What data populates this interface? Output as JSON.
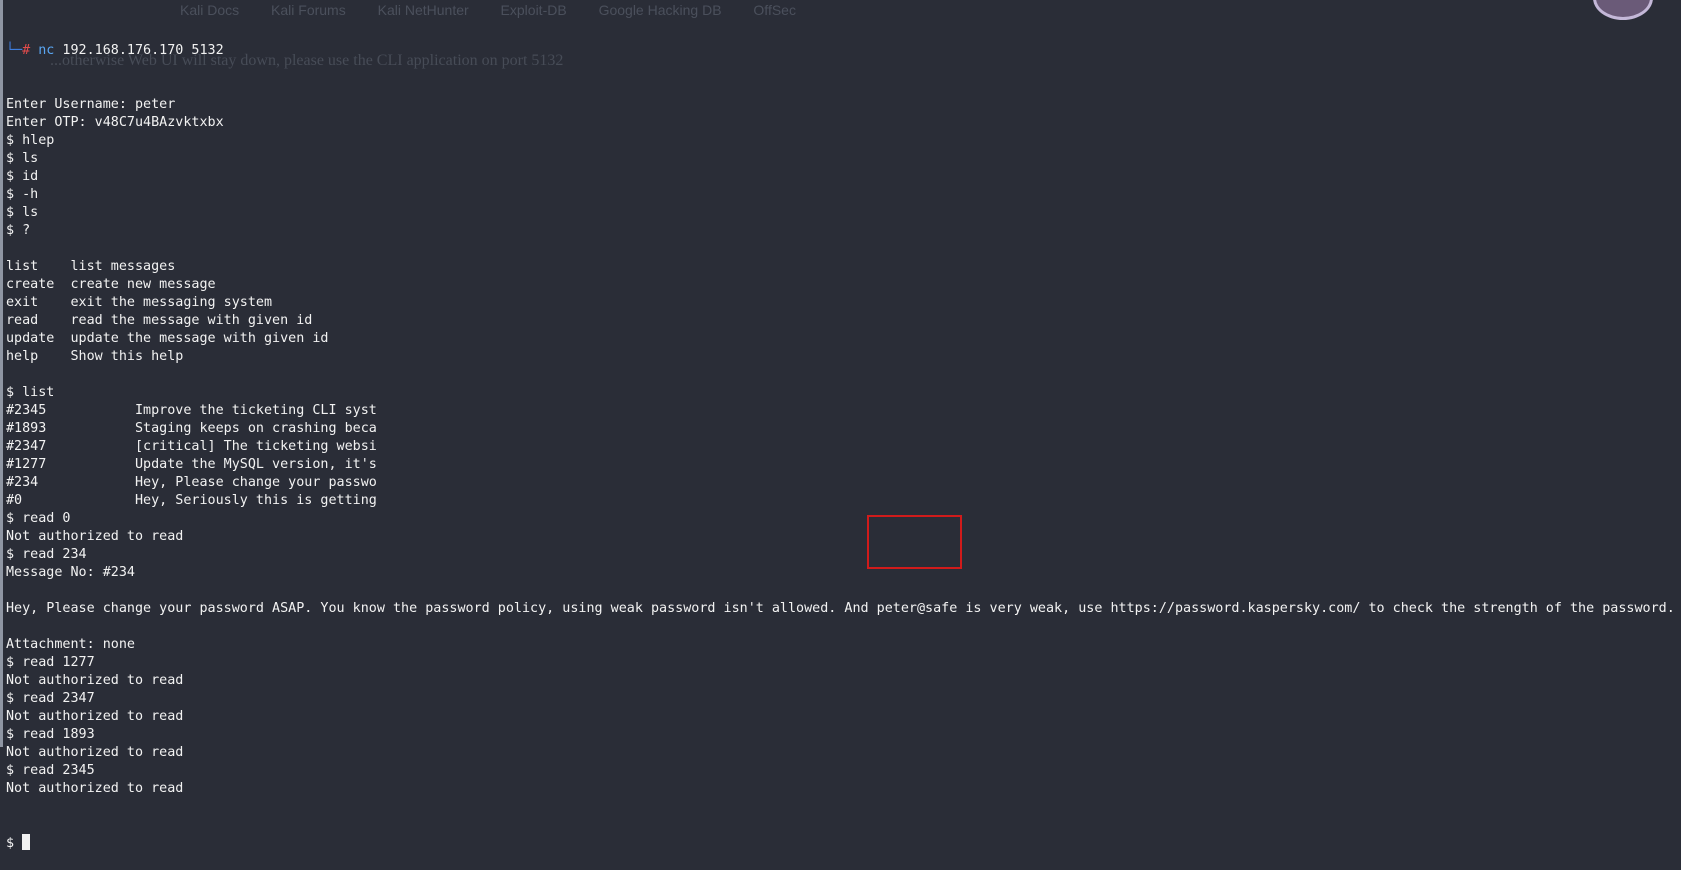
{
  "background_ghost": {
    "bookmarks": [
      "Kali Docs",
      "Kali Forums",
      "Kali NetHunter",
      "Exploit-DB",
      "Google Hacking DB",
      "OffSec"
    ],
    "page_text": "...otherwise Web UI will stay down, please use the CLI application on port 5132"
  },
  "terminal": {
    "prompt": {
      "corner": "└─",
      "hash": "#",
      "command": "nc",
      "args": " 192.168.176.170 5132"
    },
    "lines": [
      "Enter Username: peter",
      "Enter OTP: v48C7u4BAzvktxbx",
      "$ hlep",
      "$ ls",
      "$ id",
      "$ -h",
      "$ ls",
      "$ ?",
      "",
      "list    list messages",
      "create  create new message",
      "exit    exit the messaging system",
      "read    read the message with given id",
      "update  update the message with given id",
      "help    Show this help",
      "",
      "$ list",
      "#2345           Improve the ticketing CLI syst",
      "#1893           Staging keeps on crashing beca",
      "#2347           [critical] The ticketing websi",
      "#1277           Update the MySQL version, it's",
      "#234            Hey, Please change your passwo",
      "#0              Hey, Seriously this is getting",
      "$ read 0",
      "Not authorized to read",
      "$ read 234",
      "Message No: #234",
      "",
      "Hey, Please change your password ASAP. You know the password policy, using weak password isn't allowed. And peter@safe is very weak, use https://password.kaspersky.com/ to check the strength of the password.",
      "",
      "Attachment: none",
      "$ read 1277",
      "Not authorized to read",
      "$ read 2347",
      "Not authorized to read",
      "$ read 1893",
      "Not authorized to read",
      "$ read 2345",
      "Not authorized to read"
    ],
    "final_prompt": "$ "
  },
  "colors": {
    "background": "#2a2d37",
    "text": "#f2f2f2",
    "highlight": "#d11b1b"
  }
}
